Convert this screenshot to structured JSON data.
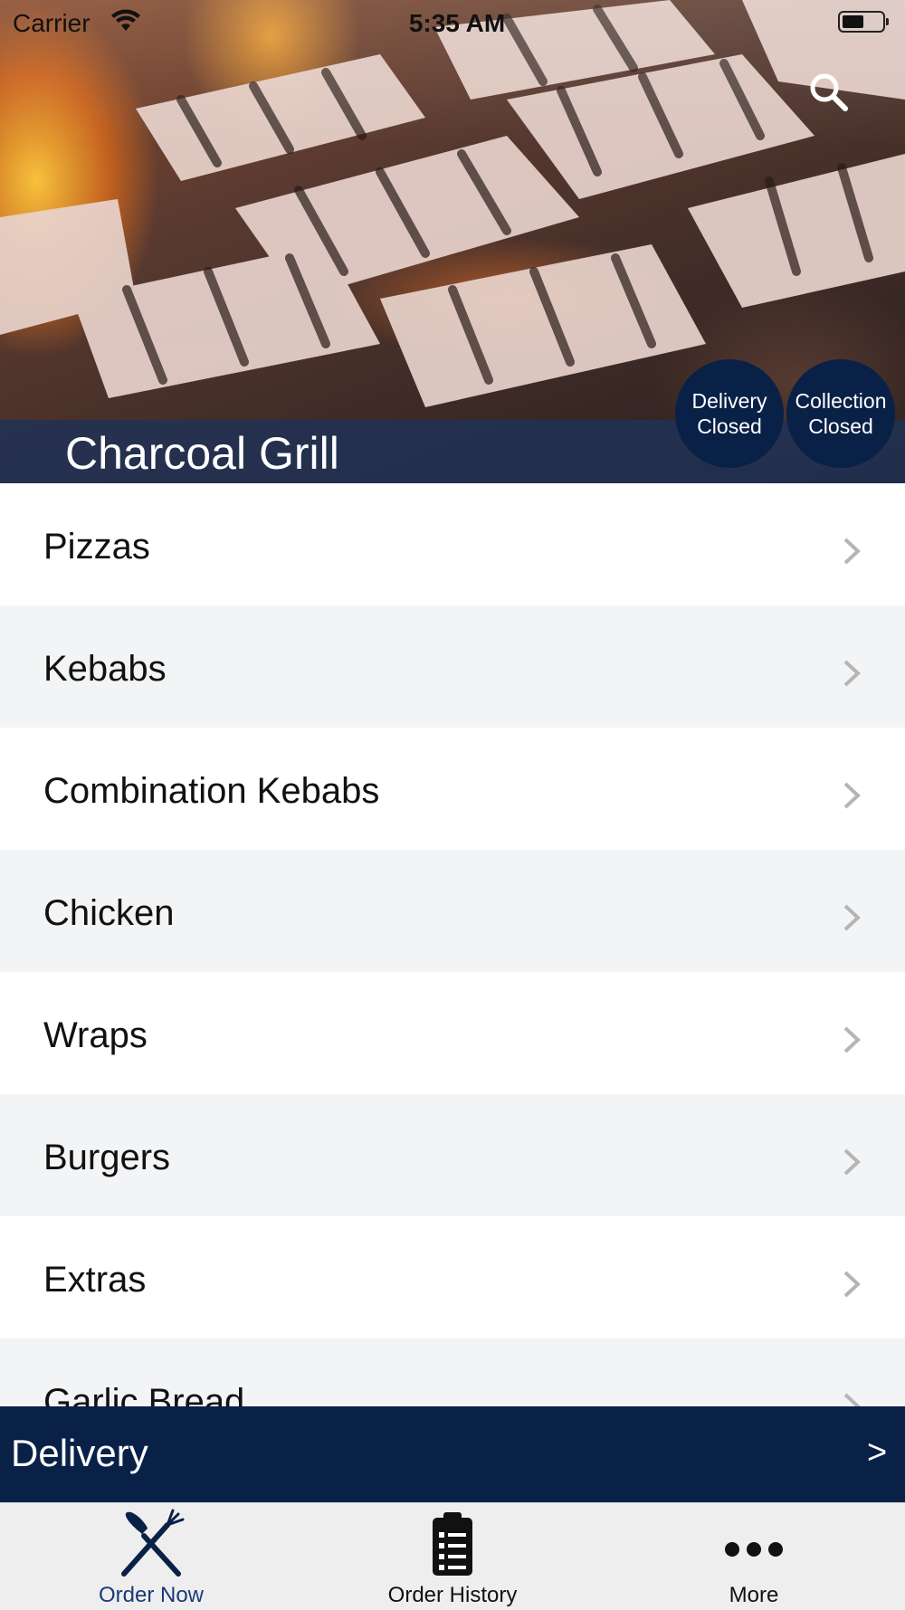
{
  "status_bar": {
    "carrier": "Carrier",
    "time": "5:35 AM",
    "battery_level": 0.55
  },
  "header": {
    "search_icon": "search-icon",
    "restaurant_name": "Charcoal Grill",
    "delivery_badge": {
      "line1": "Delivery",
      "line2": "Closed"
    },
    "collection_badge": {
      "line1": "Collection",
      "line2": "Closed"
    }
  },
  "menu": {
    "items": [
      {
        "label": "Pizzas"
      },
      {
        "label": "Kebabs"
      },
      {
        "label": "Combination Kebabs"
      },
      {
        "label": "Chicken"
      },
      {
        "label": "Wraps"
      },
      {
        "label": "Burgers"
      },
      {
        "label": "Extras"
      },
      {
        "label": "Garlic Bread"
      }
    ],
    "chevron_icon": "chevron-right-icon"
  },
  "delivery_bar": {
    "label": "Delivery",
    "arrow": ">"
  },
  "tabbar": {
    "tabs": [
      {
        "label": "Order Now",
        "icon": "fork-knife-icon",
        "active": true
      },
      {
        "label": "Order History",
        "icon": "clipboard-list-icon",
        "active": false
      },
      {
        "label": "More",
        "icon": "more-dots-icon",
        "active": false
      }
    ]
  },
  "colors": {
    "navy": "#0a2147",
    "name_bar": "#1e325a",
    "active_tab": "#1b3a78",
    "row_alt": "#f3f4f6",
    "tabbar_bg": "#eeeeee"
  }
}
